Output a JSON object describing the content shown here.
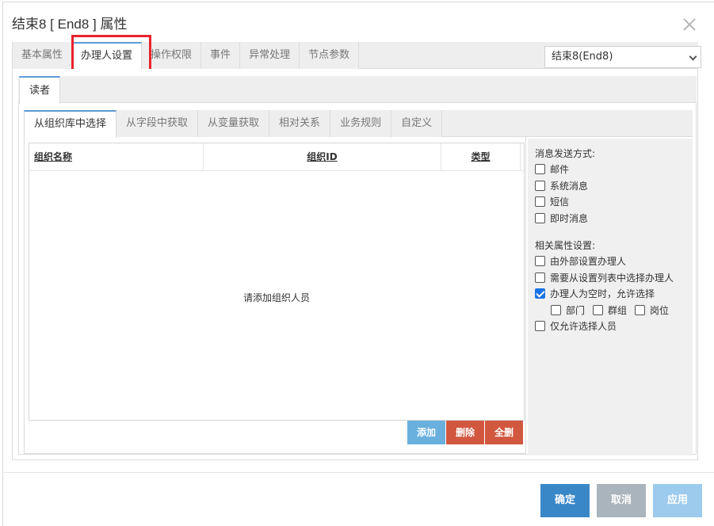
{
  "window": {
    "title": "结束8 [ End8 ] 属性"
  },
  "top_tabs": [
    {
      "label": "基本属性"
    },
    {
      "label": "办理人设置"
    },
    {
      "label": "操作权限"
    },
    {
      "label": "事件"
    },
    {
      "label": "异常处理"
    },
    {
      "label": "节点参数"
    }
  ],
  "active_top_tab": "办理人设置",
  "node_select": {
    "value": "结束8(End8)"
  },
  "reader_tab": {
    "label": "读者"
  },
  "source_tabs": [
    {
      "label": "从组织库中选择"
    },
    {
      "label": "从字段中获取"
    },
    {
      "label": "从变量获取"
    },
    {
      "label": "相对关系"
    },
    {
      "label": "业务规则"
    },
    {
      "label": "自定义"
    }
  ],
  "grid": {
    "columns": [
      "组织名称",
      "组织ID",
      "类型"
    ],
    "empty_text": "请添加组织人员"
  },
  "grid_buttons": {
    "add": "添加",
    "delete": "删除",
    "delete_all": "全删"
  },
  "message": {
    "title": "消息发送方式:",
    "options": [
      {
        "label": "邮件",
        "checked": false
      },
      {
        "label": "系统消息",
        "checked": false
      },
      {
        "label": "短信",
        "checked": false
      },
      {
        "label": "即时消息",
        "checked": false
      }
    ]
  },
  "related": {
    "title": "相关属性设置:",
    "options": [
      {
        "label": "由外部设置办理人",
        "checked": false
      },
      {
        "label": "需要从设置列表中选择办理人",
        "checked": false
      },
      {
        "label": "办理人为空时，允许选择",
        "checked": true
      }
    ],
    "sub_options": [
      {
        "label": "部门",
        "checked": false
      },
      {
        "label": "群组",
        "checked": false
      },
      {
        "label": "岗位",
        "checked": false
      }
    ],
    "last_option": {
      "label": "仅允许选择人员",
      "checked": false
    }
  },
  "footer": {
    "ok": "确定",
    "cancel": "取消",
    "apply": "应用"
  },
  "colors": {
    "accent": "#5b9bd5",
    "highlight_box": "#e8232b",
    "danger": "#d2573f",
    "primary": "#3a87c8"
  }
}
